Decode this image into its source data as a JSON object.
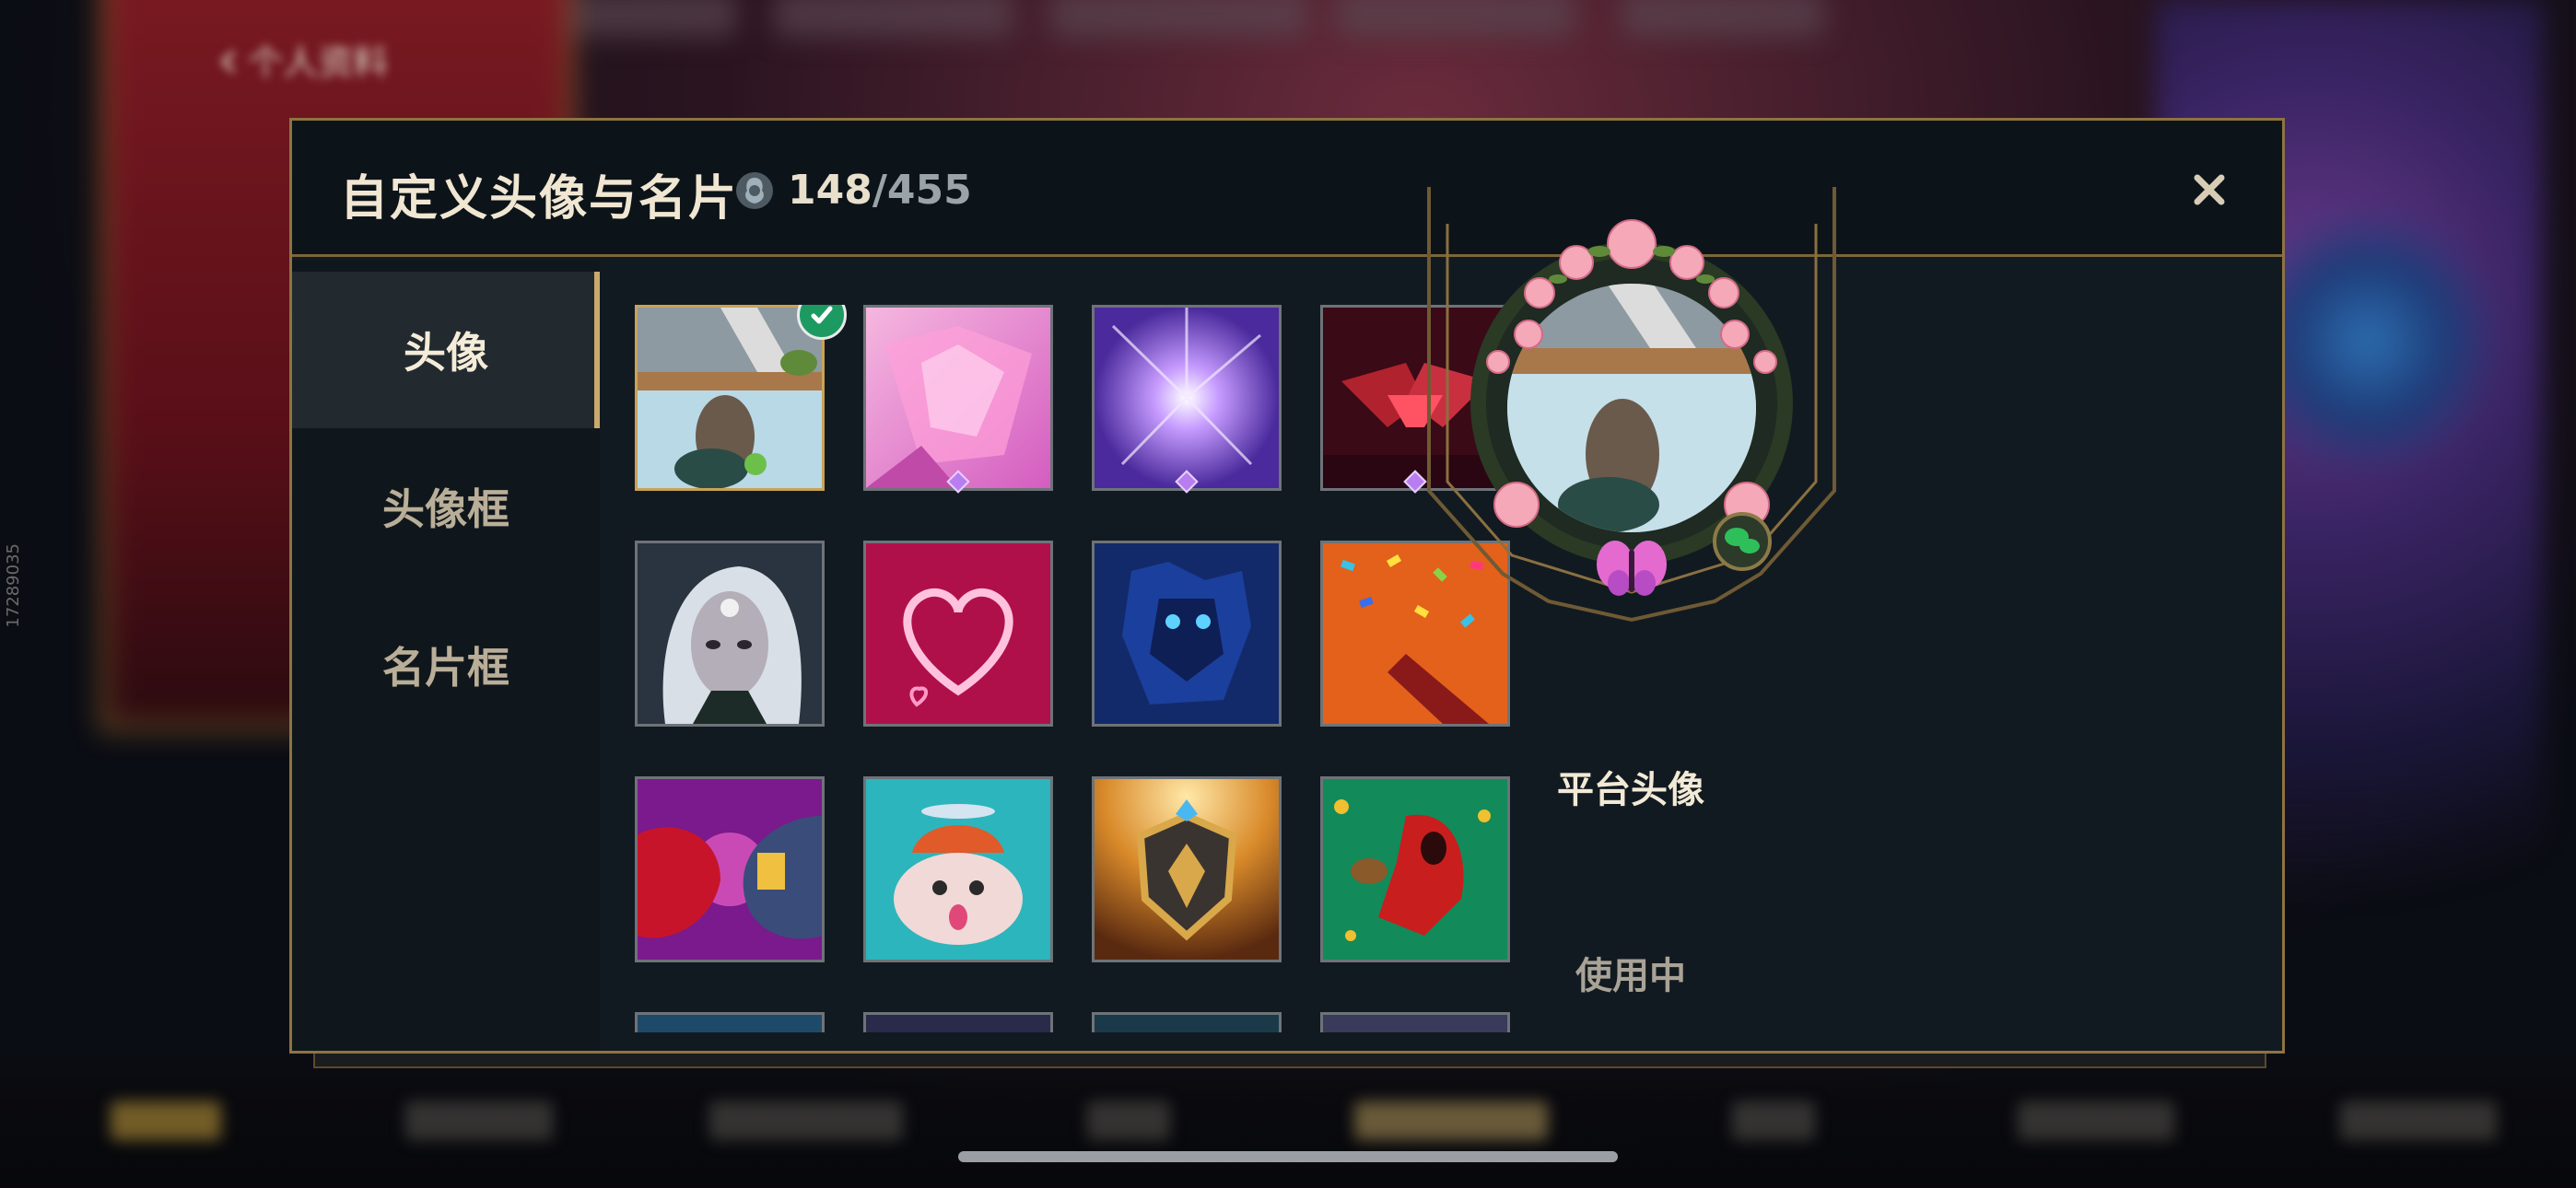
{
  "background": {
    "back_label": "个人资料",
    "side_id": "17289035"
  },
  "dialog": {
    "title": "自定义头像与名片",
    "owned_count": "148",
    "total_count": "/455",
    "close_icon": "close-icon"
  },
  "tabs": [
    {
      "label": "头像",
      "active": true
    },
    {
      "label": "头像框",
      "active": false
    },
    {
      "label": "名片框",
      "active": false
    }
  ],
  "icons": [
    {
      "name": "platform-avatar-icon",
      "selected": true,
      "rare": false
    },
    {
      "name": "pink-crystal-icon",
      "selected": false,
      "rare": true
    },
    {
      "name": "violet-burst-icon",
      "selected": false,
      "rare": true
    },
    {
      "name": "crimson-wings-icon",
      "selected": false,
      "rare": true
    },
    {
      "name": "silver-hair-champion-icon",
      "selected": false,
      "rare": false
    },
    {
      "name": "neon-heart-icon",
      "selected": false,
      "rare": false
    },
    {
      "name": "blue-golem-icon",
      "selected": false,
      "rare": false
    },
    {
      "name": "confetti-popper-icon",
      "selected": false,
      "rare": false
    },
    {
      "name": "red-blue-mech-icon",
      "selected": false,
      "rare": false
    },
    {
      "name": "poro-propeller-icon",
      "selected": false,
      "rare": false
    },
    {
      "name": "golden-shield-icon",
      "selected": false,
      "rare": false
    },
    {
      "name": "red-hooded-runner-icon",
      "selected": false,
      "rare": false
    }
  ],
  "preview": {
    "label": "平台头像",
    "status": "使用中",
    "badge_icon": "wechat-icon"
  },
  "colors": {
    "accent_gold": "#c8aa6e",
    "selected_check": "#1d9a62",
    "panel_bg": "#121a21"
  }
}
